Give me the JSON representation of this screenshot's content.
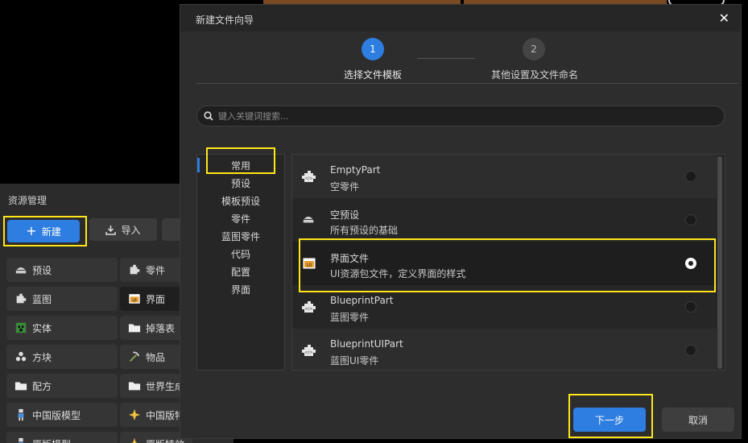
{
  "resource_panel": {
    "title": "资源管理",
    "new_label": "新建",
    "import_label": "导入",
    "items": [
      {
        "label": "预设",
        "icon": "preset-icon"
      },
      {
        "label": "零件",
        "icon": "part-icon"
      },
      {
        "label": "蓝图",
        "icon": "blueprint-icon"
      },
      {
        "label": "界面",
        "icon": "ui-icon"
      },
      {
        "label": "实体",
        "icon": "entity-icon"
      },
      {
        "label": "掉落表",
        "icon": "folder-icon"
      },
      {
        "label": "方块",
        "icon": "block-icon"
      },
      {
        "label": "物品",
        "icon": "pickaxe-icon"
      },
      {
        "label": "配方",
        "icon": "folder-icon"
      },
      {
        "label": "世界生成",
        "icon": "folder-icon"
      },
      {
        "label": "中国版模型",
        "icon": "model-icon"
      },
      {
        "label": "中国版特效",
        "icon": "effect-icon"
      },
      {
        "label": "原版模型",
        "icon": "model-icon"
      },
      {
        "label": "原版特效",
        "icon": "effect-icon"
      }
    ]
  },
  "dialog": {
    "title": "新建文件向导",
    "steps": [
      {
        "number": "1",
        "label": "选择文件模板",
        "active": true
      },
      {
        "number": "2",
        "label": "其他设置及文件命名",
        "active": false
      }
    ],
    "search_placeholder": "键入关键词搜索...",
    "categories": [
      "常用",
      "预设",
      "模板预设",
      "零件",
      "蓝图零件",
      "代码",
      "配置",
      "界面"
    ],
    "selected_category": "常用",
    "templates": [
      {
        "name": "EmptyPart",
        "desc": "空零件",
        "icon": "puzzle-icon",
        "selected": false
      },
      {
        "name": "空预设",
        "desc": "所有预设的基础",
        "icon": "preset-icon",
        "selected": false
      },
      {
        "name": "界面文件",
        "desc": "UI资源包文件，定义界面的样式",
        "icon": "ui-icon",
        "selected": true
      },
      {
        "name": "BlueprintPart",
        "desc": "蓝图零件",
        "icon": "puzzle-icon",
        "selected": false
      },
      {
        "name": "BlueprintUIPart",
        "desc": "蓝图UI零件",
        "icon": "puzzle-icon",
        "selected": false
      }
    ],
    "next_label": "下一步",
    "cancel_label": "取消"
  },
  "colors": {
    "accent": "#2e7de1",
    "highlight": "#ffe51a",
    "dialog_bg": "#2d2d2d"
  }
}
